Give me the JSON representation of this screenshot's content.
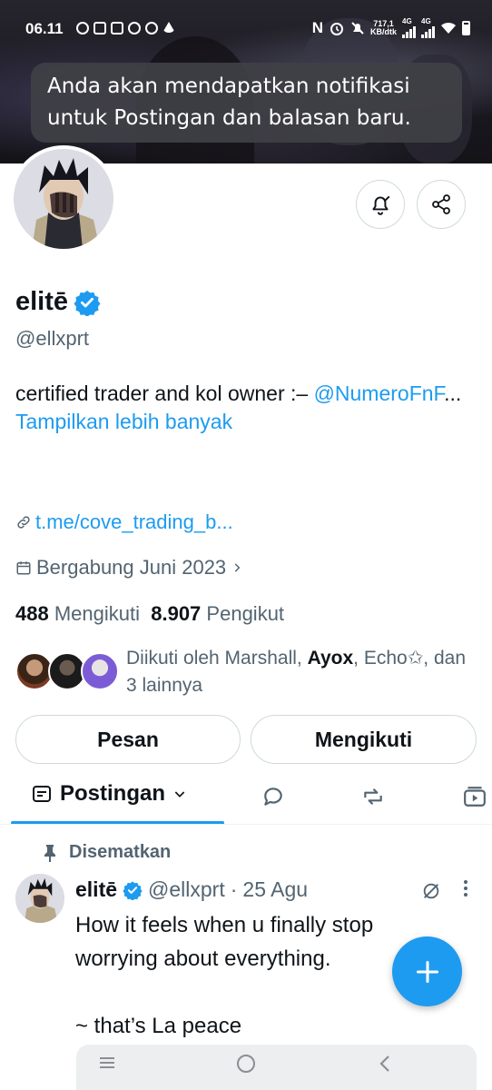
{
  "status_bar": {
    "time": "06.11",
    "network_mark": "N",
    "speed_top": "717,1",
    "speed_bottom": "KB/dtk",
    "lte1": "4G",
    "lte2": "4G",
    "left_icons": [
      "whatsapp-icon",
      "instagram-icon",
      "discord-icon",
      "messenger-icon",
      "chat-icon",
      "telegram-icon"
    ]
  },
  "toast": {
    "text": "Anda akan mendapatkan notifikasi untuk Postingan dan balasan baru."
  },
  "profile": {
    "display_name": "elitē",
    "handle": "@ellxprt",
    "bio_prefix": "certified trader and kol owner :– ",
    "bio_mention": "@NumeroFnF",
    "bio_ellipsis": "... ",
    "bio_more": "Tampilkan lebih banyak",
    "url": "t.me/cove_trading_b...",
    "joined": "Bergabung Juni 2023",
    "following_count": "488",
    "following_label": "Mengikuti",
    "followers_count": "8.907",
    "followers_label": "Pengikut",
    "followed_by_prefix": "Diikuti oleh Marshall, ",
    "followed_by_bold": "Ayox",
    "followed_by_suffix": ", Echo✩, dan 3 lainnya"
  },
  "actions": {
    "message_label": "Pesan",
    "follow_label": "Mengikuti"
  },
  "tabs": {
    "posts_label": "Postingan"
  },
  "pinned_tweet": {
    "pinned_label": "Disematkan",
    "author_name": "elitē",
    "author_handle": "@ellxprt",
    "separator": "·",
    "date": "25 Agu",
    "text": "How it feels when u finally stop worrying about everything.\n\n~ that’s La peace"
  },
  "colors": {
    "accent": "#1d9bf0",
    "text_primary": "#0f1419",
    "text_secondary": "#536471",
    "border": "#cfd9de",
    "toast_bg": "#404046"
  }
}
